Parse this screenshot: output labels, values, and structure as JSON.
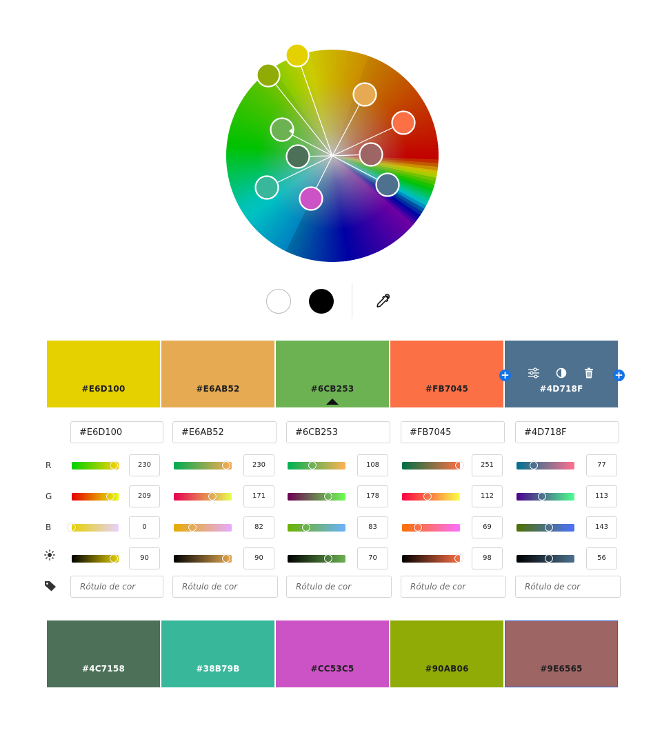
{
  "tools": {
    "white_button": "white-swatch",
    "black_button": "black-swatch",
    "eyedropper": "eyedropper-icon"
  },
  "palette": [
    {
      "hex": "#E6D100",
      "color": "#E6D100",
      "r": 230,
      "g": 209,
      "b": 0,
      "brightness": 90
    },
    {
      "hex": "#E6AB52",
      "color": "#E6AB52",
      "r": 230,
      "g": 171,
      "b": 82,
      "brightness": 90
    },
    {
      "hex": "#6CB253",
      "color": "#6CB253",
      "r": 108,
      "g": 178,
      "b": 83,
      "brightness": 70
    },
    {
      "hex": "#FB7045",
      "color": "#FB7045",
      "r": 251,
      "g": 112,
      "b": 69,
      "brightness": 98
    },
    {
      "hex": "#4D718F",
      "color": "#4D718F",
      "r": 77,
      "g": 113,
      "b": 143,
      "brightness": 56
    }
  ],
  "extra_swatches": [
    {
      "hex": "#4C7158",
      "color": "#4C7158"
    },
    {
      "hex": "#38B79B",
      "color": "#38B79B"
    },
    {
      "hex": "#CC53C5",
      "color": "#CC53C5"
    },
    {
      "hex": "#90AB06",
      "color": "#90AB06"
    },
    {
      "hex": "#9E6565",
      "color": "#9E6565"
    }
  ],
  "row_labels": {
    "r": "R",
    "g": "G",
    "b": "B"
  },
  "label_placeholder": "Rótulo de cor",
  "wheel_markers": [
    {
      "color": "#E6D100",
      "hue_deg": 52
    },
    {
      "color": "#90AB06",
      "hue_deg": 72
    },
    {
      "color": "#E6AB52",
      "hue_deg": 36
    },
    {
      "color": "#FB7045",
      "hue_deg": 14
    },
    {
      "color": "#6CB253",
      "hue_deg": 104
    },
    {
      "color": "#4C7158",
      "hue_deg": 139
    },
    {
      "color": "#9E6565",
      "hue_deg": 0
    },
    {
      "color": "#38B79B",
      "hue_deg": 167
    },
    {
      "color": "#4D718F",
      "hue_deg": 207
    },
    {
      "color": "#CC53C5",
      "hue_deg": 303
    }
  ],
  "active_index": 4,
  "base_index": 2,
  "selected_extra_index": 4
}
